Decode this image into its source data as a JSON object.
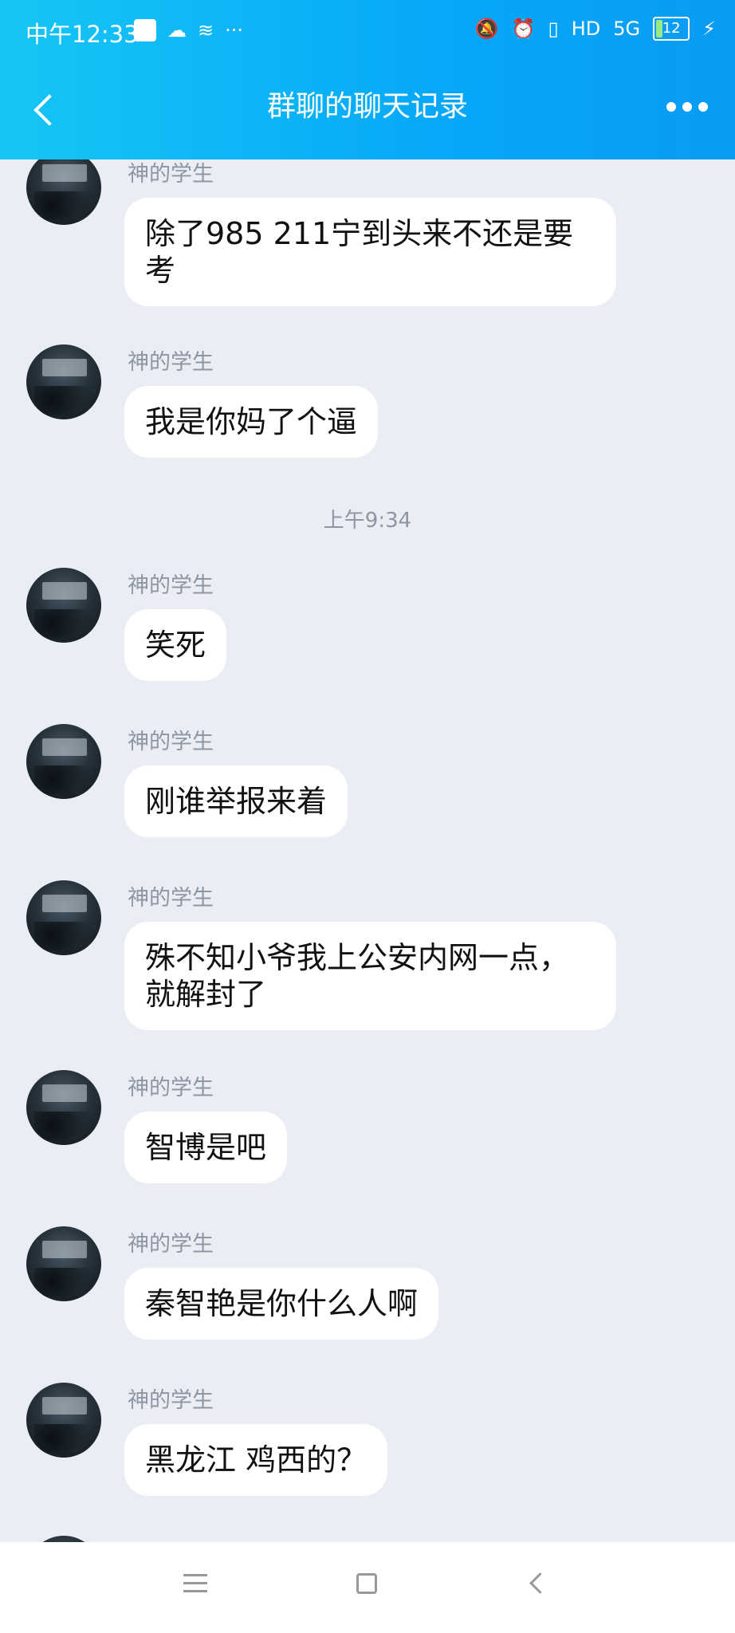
{
  "status_bar": {
    "time": "中午12:33",
    "left_glyphs": [
      "☁",
      "≋",
      "···"
    ],
    "right_glyphs": [
      "🔕",
      "⏰",
      "▯",
      "HD",
      "5G"
    ],
    "battery": "12"
  },
  "header": {
    "title": "群聊的聊天记录"
  },
  "messages": [
    {
      "sender": "神的学生",
      "text": "除了985 211宁到头来不还是要考"
    },
    {
      "sender": "神的学生",
      "text": "我是你妈了个逼"
    },
    {
      "timestamp": "上午9:34"
    },
    {
      "sender": "神的学生",
      "text": "笑死"
    },
    {
      "sender": "神的学生",
      "text": "刚谁举报来着"
    },
    {
      "sender": "神的学生",
      "text": "殊不知小爷我上公安内网一点，就解封了"
    },
    {
      "sender": "神的学生",
      "text": "智博是吧"
    },
    {
      "sender": "神的学生",
      "text": "秦智艳是你什么人啊"
    },
    {
      "sender": "神的学生",
      "text": "黑龙江 鸡西的？"
    }
  ]
}
